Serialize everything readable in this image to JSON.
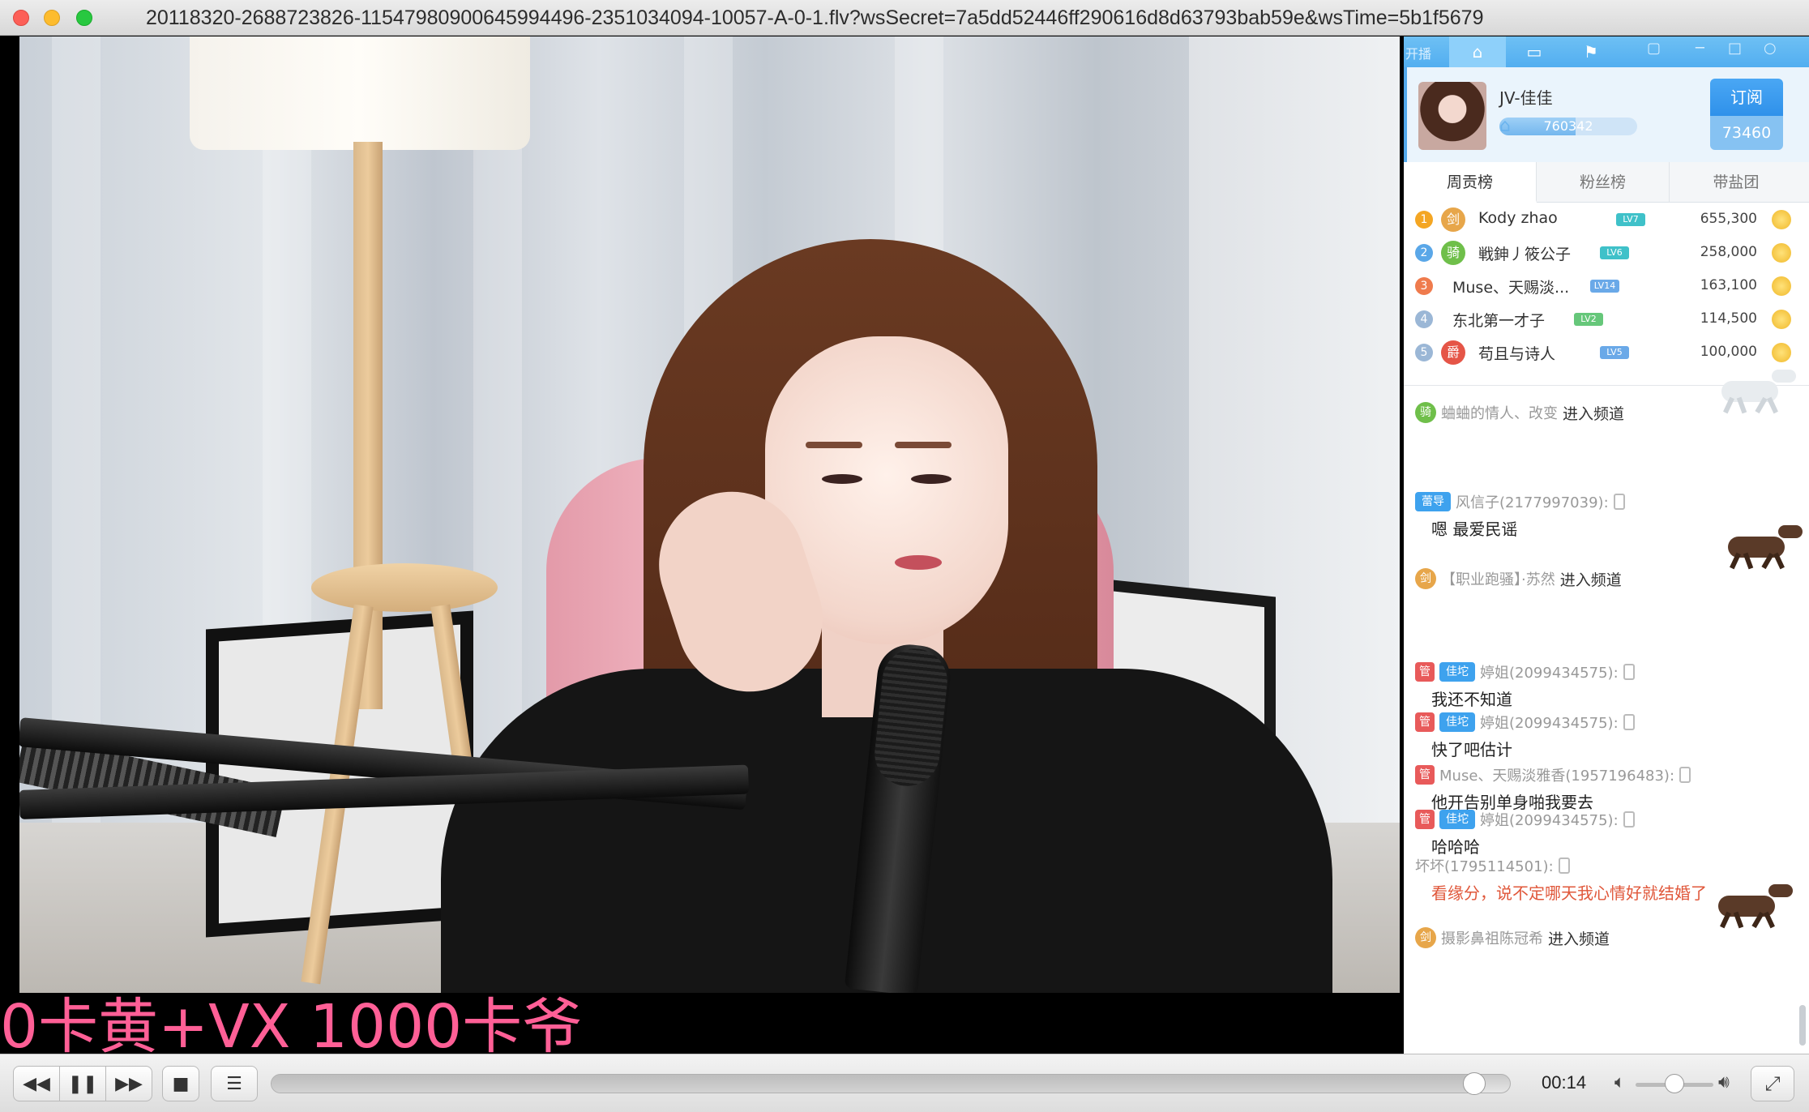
{
  "window": {
    "title": "20118320-2688723826-11547980900645994496-2351034094-10057-A-0-1.flv?wsSecret=7a5dd52446ff290616d8d63793bab59e&wsTime=5b1f5679"
  },
  "video": {
    "overlay_text": "0卡黄+VX  1000卡爷"
  },
  "panel": {
    "topbar": {
      "left_fragment": "开播"
    },
    "anchor": {
      "name": "JV-佳佳",
      "level_value": "760342",
      "level_progress": 0.55,
      "subscribe_label": "订阅",
      "subscribe_count": "73460"
    },
    "rank_tabs": [
      "周贡榜",
      "粉丝榜",
      "带盐团"
    ],
    "rank_active": 0,
    "ranking": [
      {
        "rank": "1",
        "badge": "剑",
        "name": "Kody zhao",
        "level": "LV7",
        "score": "655,300"
      },
      {
        "rank": "2",
        "badge": "骑",
        "name": "戦鉮丿筱公子",
        "level": "LV6",
        "score": "258,000"
      },
      {
        "rank": "3",
        "badge": "",
        "name": "Muse、天赐淡...",
        "level": "LV14",
        "score": "163,100"
      },
      {
        "rank": "4",
        "badge": "",
        "name": "东北第一才子",
        "level": "LV2",
        "score": "114,500"
      },
      {
        "rank": "5",
        "badge": "爵",
        "name": "苟且与诗人",
        "level": "LV5",
        "score": "100,000"
      }
    ],
    "chat": [
      {
        "type": "enter",
        "badge": "骑",
        "user": "蛐蛐的情人、改变",
        "action": "进入频道"
      },
      {
        "type": "msg",
        "badges": [
          "蕾导"
        ],
        "user": "风信子(2177997039):",
        "text": "嗯 最爱民谣"
      },
      {
        "type": "enter",
        "badge": "剑",
        "user": "【职业跑骚】·苏然",
        "action": "进入频道"
      },
      {
        "type": "msg",
        "badges": [
          "管",
          "佳坨"
        ],
        "user": "婷姐(2099434575):",
        "text": "我还不知道"
      },
      {
        "type": "msg",
        "badges": [
          "管",
          "佳坨"
        ],
        "user": "婷姐(2099434575):",
        "text": "快了吧估计"
      },
      {
        "type": "msg",
        "badges": [
          "管"
        ],
        "user": "Muse、天赐淡雅香(1957196483):",
        "text": "他开告别单身啪我要去"
      },
      {
        "type": "msg",
        "badges": [
          "管",
          "佳坨"
        ],
        "user": "婷姐(2099434575):",
        "text": "哈哈哈"
      },
      {
        "type": "msg",
        "badges": [],
        "user": "坏坏(1795114501):",
        "text": "看缘分，说不定哪天我心情好就结婚了"
      },
      {
        "type": "enter",
        "badge": "剑",
        "user": "摄影鼻祖陈冠希",
        "action": "进入频道"
      }
    ]
  },
  "player": {
    "time": "00:14",
    "progress": 0.97,
    "volume": 0.5,
    "buttons": {
      "rewind": "◀◀",
      "pause": "❚❚",
      "forward": "▶▶",
      "stop": "■",
      "playlist": "☰",
      "fullscreen": "⤢"
    }
  },
  "colors": {
    "accent": "#3ea2ee",
    "overlay": "#ff5f96",
    "admin": "#e85a5a"
  }
}
